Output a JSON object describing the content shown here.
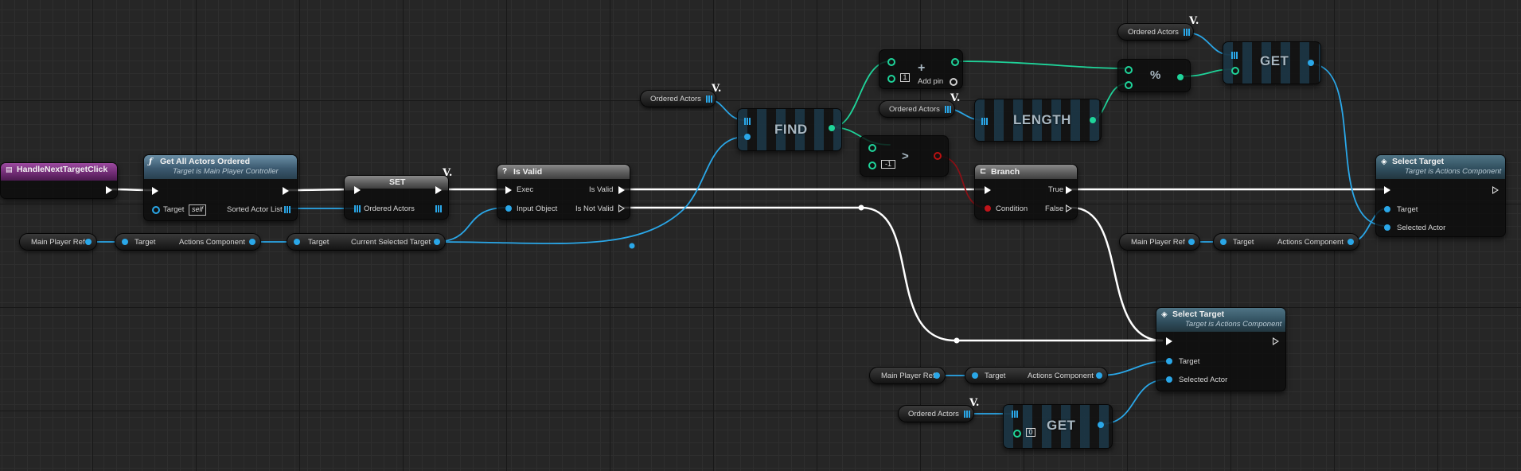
{
  "event": {
    "title": "HandleNextTargetClick"
  },
  "get_all_actors": {
    "title": "Get All Actors Ordered",
    "subtitle": "Target is Main Player Controller",
    "target_label": "Target",
    "target_value": "self",
    "output_label": "Sorted Actor List"
  },
  "set_node": {
    "title": "SET",
    "input_label": "Ordered Actors"
  },
  "is_valid": {
    "title": "Is Valid",
    "exec_label": "Exec",
    "valid_label": "Is Valid",
    "input_label": "Input Object",
    "not_valid_label": "Is Not Valid"
  },
  "branch": {
    "title": "Branch",
    "true_label": "True",
    "condition_label": "Condition",
    "false_label": "False"
  },
  "select_target_top": {
    "title": "Select Target",
    "subtitle": "Target is Actions Component",
    "target_label": "Target",
    "actor_label": "Selected Actor"
  },
  "select_target_bottom": {
    "title": "Select Target",
    "subtitle": "Target is Actions Component",
    "target_label": "Target",
    "actor_label": "Selected Actor"
  },
  "find_node": {
    "title": "FIND"
  },
  "length_node": {
    "title": "LENGTH"
  },
  "get_top": {
    "title": "GET"
  },
  "get_bottom": {
    "title": "GET",
    "index_value": "0"
  },
  "add_node": {
    "symbol": "+",
    "const_value": "1",
    "add_pin_label": "Add pin"
  },
  "modulo_node": {
    "symbol": "%"
  },
  "greater_node": {
    "symbol": ">",
    "const_value": "-1"
  },
  "variables": {
    "main_player_ref": "Main Player Ref",
    "ordered_actors": "Ordered Actors",
    "target_label": "Target",
    "actions_component": "Actions Component",
    "current_selected_target": "Current Selected Target"
  },
  "colors": {
    "exec": "#ffffff",
    "object": "#2aa7e8",
    "integer": "#1fd49a",
    "boolean": "#c0141a"
  }
}
